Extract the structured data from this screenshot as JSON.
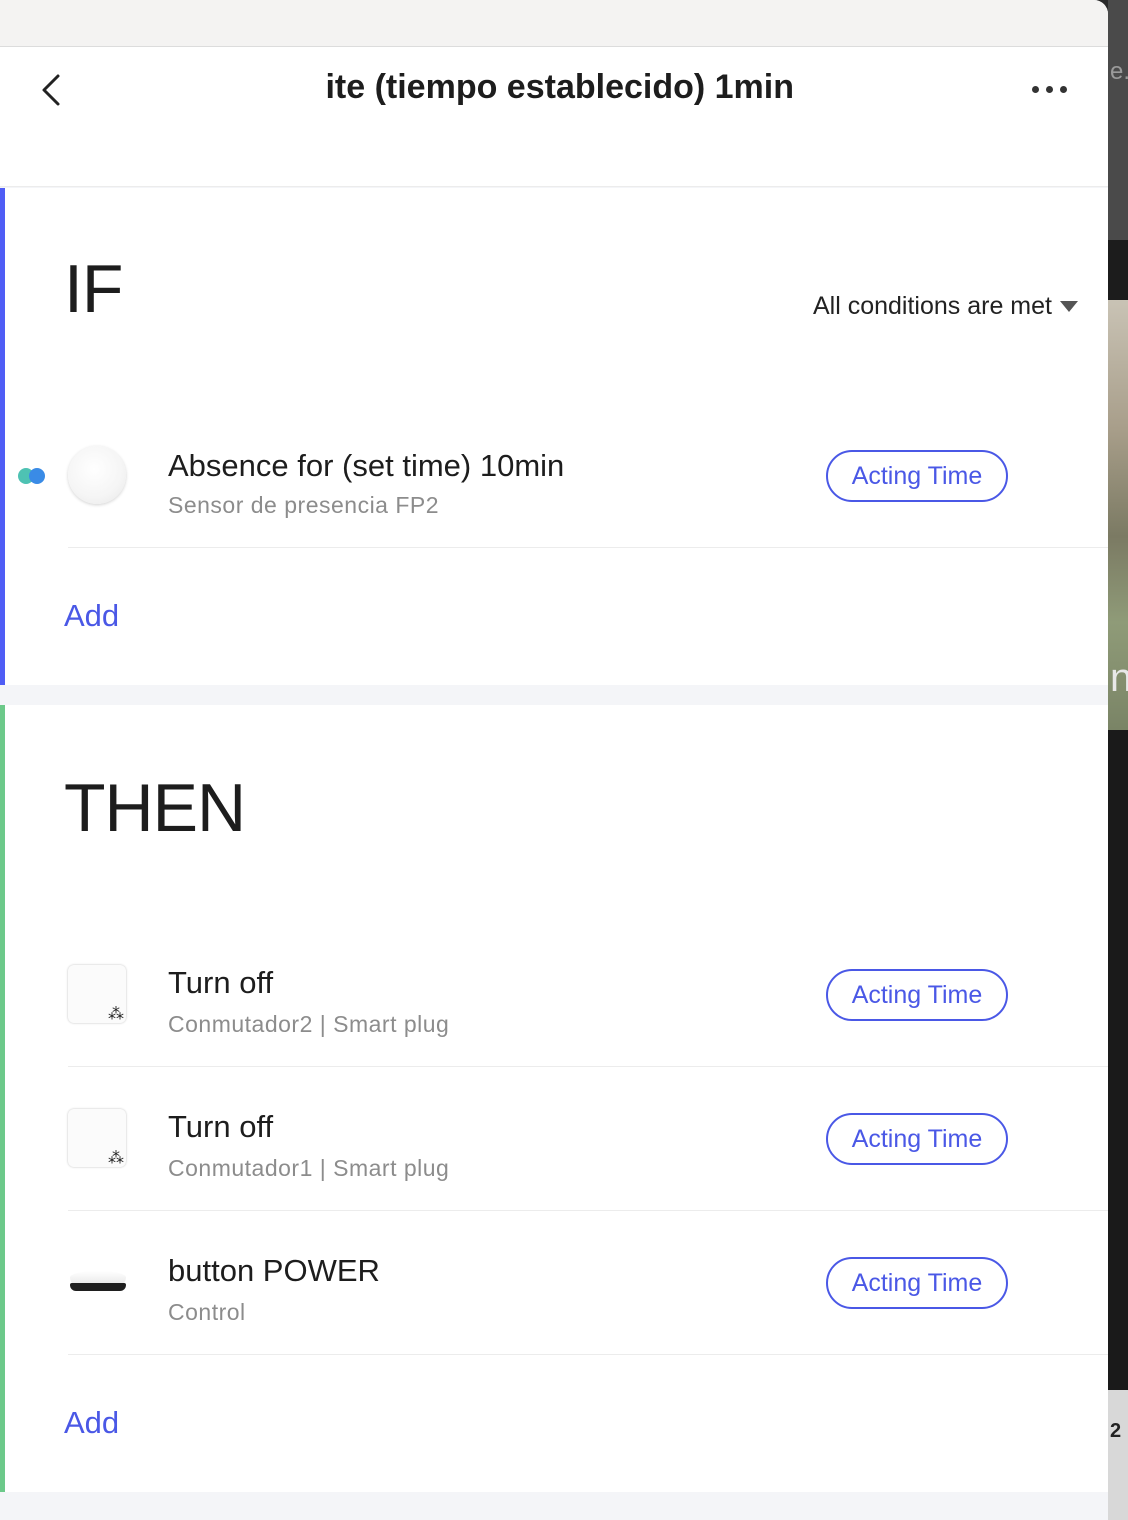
{
  "header": {
    "title": "ite (tiempo establecido) 1min",
    "back_icon": "chevron-left-icon",
    "more_icon": "ellipsis-icon"
  },
  "if_section": {
    "title": "IF",
    "condition_mode": "All conditions are met",
    "items": [
      {
        "action": "Absence for (set time) 10min",
        "device": "Sensor de presencia FP2",
        "button": "Acting Time",
        "icon": "presence-sensor-icon"
      }
    ],
    "add_label": "Add"
  },
  "then_section": {
    "title": "THEN",
    "items": [
      {
        "action": "Turn off",
        "device": "Conmutador2 | Smart plug",
        "button": "Acting Time",
        "icon": "smart-plug-icon"
      },
      {
        "action": "Turn off",
        "device": "Conmutador1 | Smart plug",
        "button": "Acting Time",
        "icon": "smart-plug-icon"
      },
      {
        "action": "button POWER",
        "device": "Control",
        "button": "Acting Time",
        "icon": "ir-remote-hub-icon"
      }
    ],
    "add_label": "Add"
  },
  "colors": {
    "accent_blue": "#4a58e6",
    "if_bar": "#4f5df5",
    "then_bar": "#6cc98a",
    "indicator_teal": "#4ec2b3",
    "indicator_blue": "#3a8be6"
  },
  "background_window": {
    "text_top": "e.",
    "text_mid": "n",
    "text_bottom": "2"
  }
}
